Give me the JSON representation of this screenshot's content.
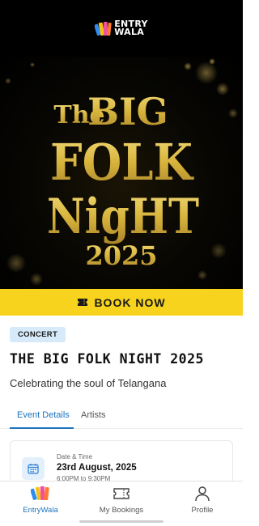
{
  "app": {
    "logo_line1": "ENTRY",
    "logo_line2": "WALA"
  },
  "banner": {
    "the": "The",
    "big": "BIG",
    "folk": "FOLK",
    "night": "NigHT",
    "year": "2025"
  },
  "cta": {
    "label": "BOOK NOW",
    "icon": "ticket-icon"
  },
  "event": {
    "category": "CONCERT",
    "title": "THE BIG FOLK NIGHT 2025",
    "tagline": "Celebrating the soul of Telangana"
  },
  "tabs": [
    {
      "label": "Event Details",
      "active": true
    },
    {
      "label": "Artists",
      "active": false
    }
  ],
  "details": {
    "date_label": "Date & Time",
    "date_value": "23rd August, 2025",
    "time_value": "6:00PM to 9:30PM",
    "icon": "calendar-icon"
  },
  "nav": [
    {
      "label": "EntryWala",
      "icon": "entrywala-logo-icon",
      "active": true
    },
    {
      "label": "My Bookings",
      "icon": "ticket-icon",
      "active": false
    },
    {
      "label": "Profile",
      "icon": "user-icon",
      "active": false
    }
  ],
  "colors": {
    "accent": "#1e73be",
    "cta": "#f7d31e",
    "gold": "#d8b43c",
    "tag_bg": "#d6eaf9"
  }
}
